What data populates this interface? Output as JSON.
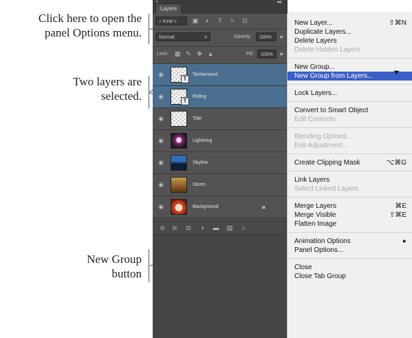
{
  "callouts": {
    "options_menu": [
      "Click here to open the",
      "panel Options menu."
    ],
    "two_layers": [
      "Two layers are",
      "selected."
    ],
    "new_group": [
      "New Group",
      "button"
    ]
  },
  "panel": {
    "tab": "Layers",
    "filter_kind": "Kind",
    "blend_mode": "Normal",
    "opacity_label": "Opacity:",
    "opacity_value": "100%",
    "lock_label": "Lock:",
    "fill_label": "Fill:",
    "fill_value": "100%",
    "layers": [
      {
        "name": "Tantamount",
        "selected": true,
        "thumb": "checker",
        "text_layer": true
      },
      {
        "name": "Riding",
        "selected": true,
        "thumb": "checker",
        "text_layer": true
      },
      {
        "name": "Title",
        "selected": false,
        "thumb": "checker",
        "text_layer": false
      },
      {
        "name": "Lightning",
        "selected": false,
        "thumb": "lightning",
        "text_layer": false
      },
      {
        "name": "Skyline",
        "selected": false,
        "thumb": "skyline",
        "text_layer": false
      },
      {
        "name": "Storm",
        "selected": false,
        "thumb": "storm",
        "text_layer": false
      },
      {
        "name": "Background",
        "selected": false,
        "thumb": "background",
        "text_layer": false,
        "locked": true
      }
    ]
  },
  "menu": {
    "groups": [
      [
        {
          "label": "New Layer...",
          "shortcut": "⇧⌘N"
        },
        {
          "label": "Duplicate Layers...",
          "shortcut": ""
        },
        {
          "label": "Delete Layers",
          "shortcut": ""
        },
        {
          "label": "Delete Hidden Layers",
          "shortcut": "",
          "disabled": true
        }
      ],
      [
        {
          "label": "New Group...",
          "shortcut": ""
        },
        {
          "label": "New Group from Layers...",
          "shortcut": "",
          "highlighted": true
        }
      ],
      [
        {
          "label": "Lock Layers...",
          "shortcut": ""
        }
      ],
      [
        {
          "label": "Convert to Smart Object",
          "shortcut": ""
        },
        {
          "label": "Edit Contents",
          "shortcut": "",
          "disabled": true
        }
      ],
      [
        {
          "label": "Blending Options...",
          "shortcut": "",
          "disabled": true
        },
        {
          "label": "Edit Adjustment...",
          "shortcut": "",
          "disabled": true
        }
      ],
      [
        {
          "label": "Create Clipping Mask",
          "shortcut": "⌥⌘G"
        }
      ],
      [
        {
          "label": "Link Layers",
          "shortcut": ""
        },
        {
          "label": "Select Linked Layers",
          "shortcut": "",
          "disabled": true
        }
      ],
      [
        {
          "label": "Merge Layers",
          "shortcut": "⌘E"
        },
        {
          "label": "Merge Visible",
          "shortcut": "⇧⌘E"
        },
        {
          "label": "Flatten Image",
          "shortcut": ""
        }
      ],
      [
        {
          "label": "Animation Options",
          "shortcut": "▸"
        },
        {
          "label": "Panel Options...",
          "shortcut": ""
        }
      ],
      [
        {
          "label": "Close",
          "shortcut": ""
        },
        {
          "label": "Close Tab Group",
          "shortcut": ""
        }
      ]
    ]
  },
  "colors": {
    "selected_layer": "#4a6f91",
    "menu_highlight": "#3b5ec9",
    "panel_bg": "#535353"
  }
}
